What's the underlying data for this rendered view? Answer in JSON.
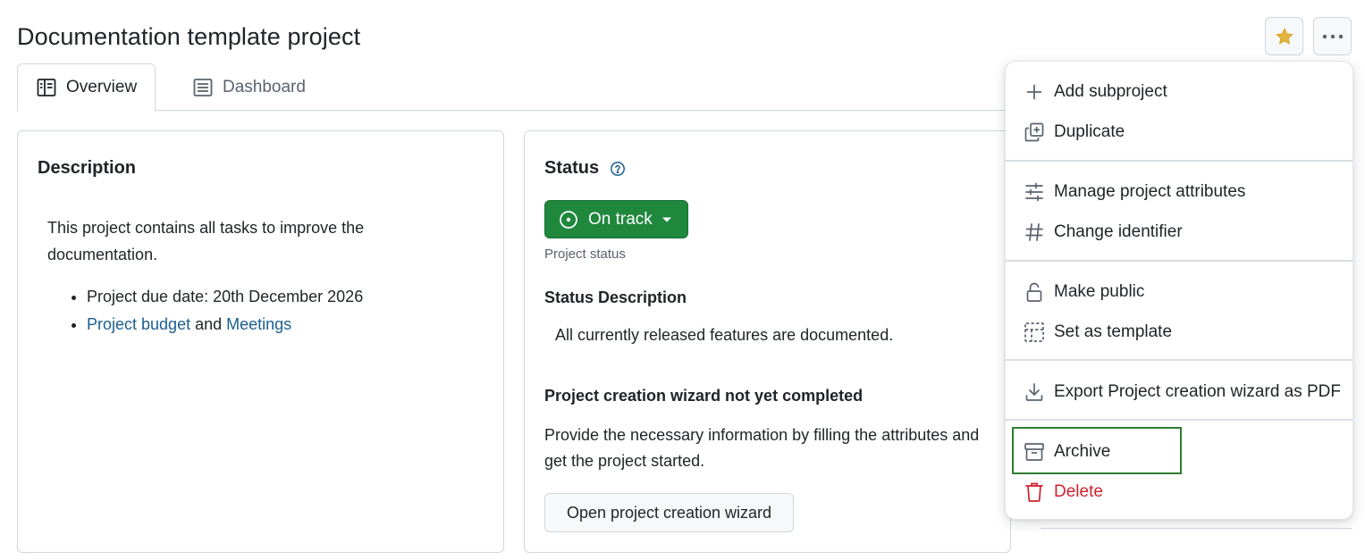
{
  "header": {
    "title": "Documentation template project"
  },
  "actions": {
    "favorite_icon": "star-icon",
    "more_icon": "kebab-icon",
    "star_color": "#e3b341"
  },
  "tabs": [
    {
      "label": "Overview",
      "icon": "book-icon",
      "active": true
    },
    {
      "label": "Dashboard",
      "icon": "list-icon",
      "active": false
    }
  ],
  "description": {
    "heading": "Description",
    "text": "This project contains all tasks to improve the documentation.",
    "bullet1": "Project due date: 20th December 2026",
    "link_budget": "Project budget",
    "and_text": " and ",
    "link_meetings": "Meetings",
    "link_color": "#1b5e8f"
  },
  "status": {
    "heading": "Status",
    "badge_label": "On track",
    "badge_color": "#1f883d",
    "caption": "Project status",
    "desc_heading": "Status Description",
    "desc_text": "All currently released features are documented.",
    "wizard_heading": "Project creation wizard not yet completed",
    "wizard_text": "Provide the necessary information by filling the attributes and get the project started.",
    "wizard_button": "Open project creation wizard"
  },
  "menu": {
    "items": [
      {
        "label": "Add subproject",
        "icon": "plus-icon"
      },
      {
        "label": "Duplicate",
        "icon": "duplicate-icon"
      },
      {
        "label": "Manage project attributes",
        "icon": "sliders-icon"
      },
      {
        "label": "Change identifier",
        "icon": "hash-icon"
      },
      {
        "label": "Make public",
        "icon": "unlock-icon"
      },
      {
        "label": "Set as template",
        "icon": "template-icon"
      },
      {
        "label": "Export Project creation wizard as PDF",
        "icon": "download-icon"
      },
      {
        "label": "Archive",
        "icon": "archive-icon"
      },
      {
        "label": "Delete",
        "icon": "trash-icon",
        "danger": true
      }
    ],
    "danger_color": "#cf222e",
    "focus_color": "#2f7d32"
  }
}
